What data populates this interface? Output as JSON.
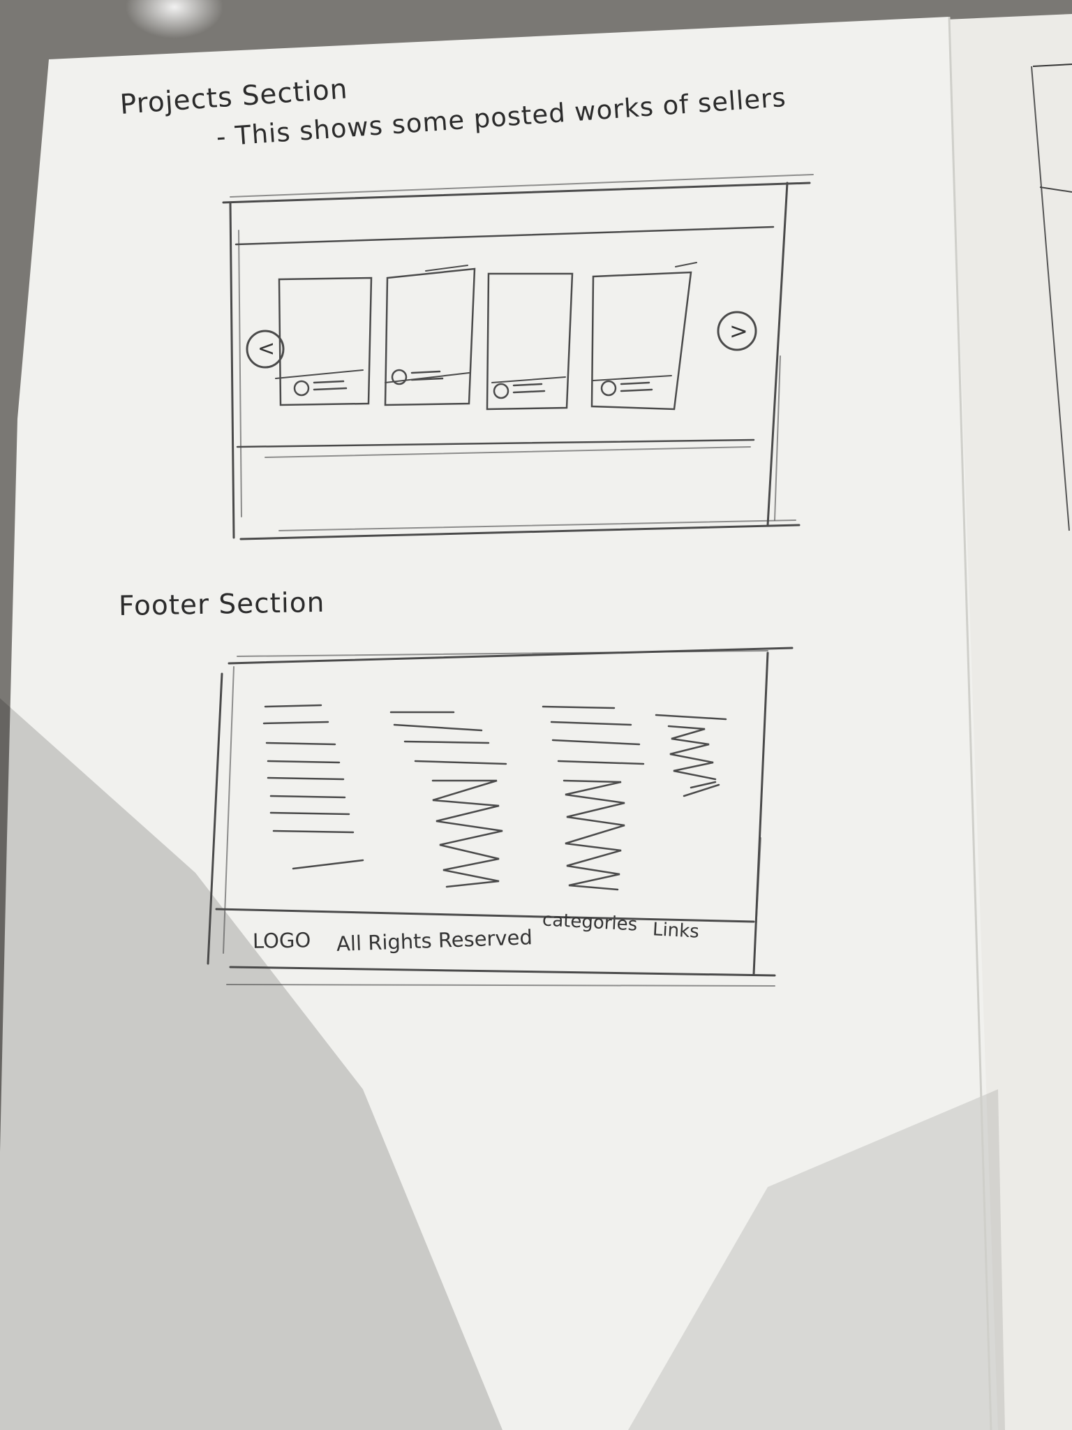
{
  "projects_section": {
    "heading": "Projects Section",
    "description": "- This shows some posted works of sellers",
    "carousel": {
      "prev_glyph": "<",
      "next_glyph": ">",
      "prev_icon": "chevron-left-icon",
      "next_icon": "chevron-right-icon",
      "card_count": 4
    }
  },
  "footer_section": {
    "heading": "Footer Section",
    "logo": "LOGO",
    "rights": "All Rights Reserved",
    "categories": "categories",
    "links": "Links"
  },
  "colors": {
    "paper": "#f1f1ee",
    "pencil": "#4a4a4a",
    "background": "#6e6c68"
  }
}
